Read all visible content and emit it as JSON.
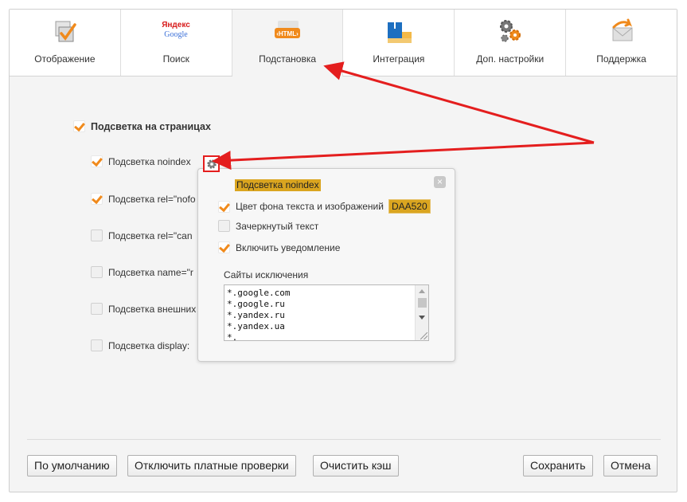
{
  "tabs": [
    {
      "label": "Отображение",
      "icon": "display-checkbox-icon"
    },
    {
      "label": "Поиск",
      "icon": "yandex-google-icon",
      "icon_text_top": "Яндекс",
      "icon_text_bottom": "Google"
    },
    {
      "label": "Подстановка",
      "icon": "html-tag-icon",
      "icon_text": "‹HTML›",
      "active": true
    },
    {
      "label": "Интеграция",
      "icon": "integration-blocks-icon"
    },
    {
      "label": "Доп. настройки",
      "icon": "gears-icon"
    },
    {
      "label": "Поддержка",
      "icon": "envelope-arrow-icon"
    }
  ],
  "main": {
    "highlight_on_pages": {
      "label": "Подсветка на страницах",
      "checked": true
    },
    "items": [
      {
        "label": "Подсветка noindex",
        "checked": true
      },
      {
        "label": "Подсветка rel=\"nofo",
        "checked": true
      },
      {
        "label": "Подсветка rel=\"can",
        "checked": false
      },
      {
        "label": "Подсветка name=\"r",
        "checked": false
      },
      {
        "label": "Подсветка внешних",
        "checked": false
      },
      {
        "label": "Подсветка display:",
        "checked": false
      }
    ]
  },
  "popup": {
    "title": "Подсветка noindex",
    "close_icon": "close-icon",
    "bg_color": {
      "label": "Цвет фона текста и изображений",
      "value": "DAA520",
      "checked": true
    },
    "strikethrough": {
      "label": "Зачеркнутый текст",
      "checked": false
    },
    "notification": {
      "label": "Включить уведомление",
      "checked": true
    },
    "exceptions_label": "Сайты исключения",
    "exceptions_text": "*.google.com\n*.google.ru\n*.yandex.ru\n*.yandex.ua\n*."
  },
  "buttons": {
    "defaults": "По умолчанию",
    "disable_paid": "Отключить платные проверки",
    "clear_cache": "Очистить кэш",
    "save": "Сохранить",
    "cancel": "Отмена"
  },
  "colors": {
    "accent": "#f08a1c",
    "highlight": "#daa520",
    "annotation": "#e41e1e"
  }
}
